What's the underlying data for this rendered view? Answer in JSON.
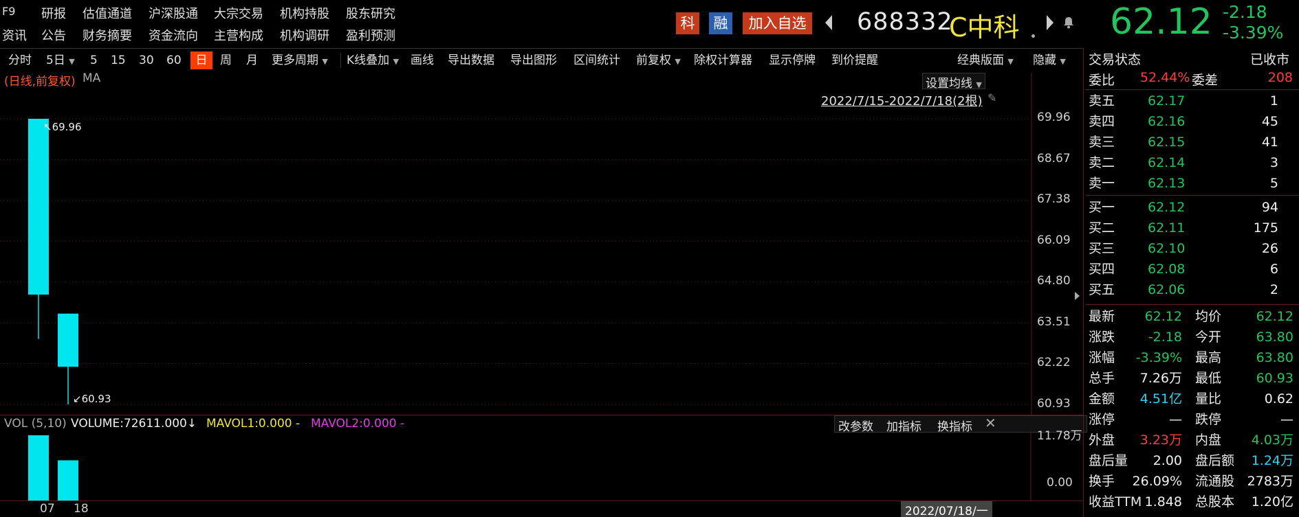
{
  "menu": {
    "row1": [
      "F9",
      "研报",
      "估值通道",
      "沪深股通",
      "大宗交易",
      "机构持股",
      "股东研究"
    ],
    "row2": [
      "资讯",
      "公告",
      "财务摘要",
      "资金流向",
      "主营构成",
      "机构调研",
      "盈利预测"
    ]
  },
  "header": {
    "badge_ke": "科",
    "badge_rong": "融",
    "add_watch": "加入自选",
    "code": "688332",
    "name": "C中科",
    "price": "62.12",
    "change": "-2.18",
    "change_pct": "-3.39%"
  },
  "toolbar": {
    "periods": [
      "分时",
      "5日",
      "5",
      "15",
      "30",
      "60",
      "日",
      "周",
      "月",
      "更多周期"
    ],
    "active_period": "日",
    "tools": [
      "K线叠加",
      "画线",
      "导出数据",
      "导出图形",
      "区间统计",
      "前复权",
      "除权计算器",
      "显示停牌",
      "到价提醒"
    ],
    "layout": "经典版面",
    "hide": "隐藏"
  },
  "chart": {
    "title_type": "(日线,前复权)",
    "title_ma": "MA",
    "set_ma": "设置均线",
    "range_label": "2022/7/15-2022/7/18(2根)",
    "high_annot": "69.96",
    "low_annot": "60.93",
    "y_ticks": [
      "69.96",
      "68.67",
      "67.38",
      "66.09",
      "64.80",
      "63.51",
      "62.22",
      "60.93"
    ],
    "vol_title": "VOL (5,10)",
    "vol_value": "VOLUME:72611.000",
    "mavol1": "MAVOL1:0.000 -",
    "mavol2": "MAVOL2:0.000 -",
    "vol_btns": [
      "改参数",
      "加指标",
      "换指标"
    ],
    "vol_ticks": [
      "11.78万",
      "0.00"
    ],
    "x_labels": [
      "07",
      "18"
    ],
    "cursor_date": "2022/07/18/一",
    "colors": {
      "up": "#ff3d3d",
      "down": "#00e5ee",
      "grid": "#5a1a1a"
    }
  },
  "chart_data": {
    "type": "candlestick",
    "ylim": [
      60.93,
      69.96
    ],
    "candles": [
      {
        "date": "2022/7/15",
        "open": 69.96,
        "close": 64.4,
        "high": 69.96,
        "low": 63.0
      },
      {
        "date": "2022/7/18",
        "open": 63.8,
        "close": 62.12,
        "high": 63.8,
        "low": 60.93
      }
    ],
    "volume": [
      117800,
      72611
    ],
    "vol_ylim": [
      0,
      117800
    ]
  },
  "orderbook": {
    "title": "交易状态",
    "status": "已收市",
    "webi_label": "委比",
    "webi": "52.44%",
    "weicha_label": "委差",
    "weicha": "208",
    "asks": [
      {
        "label": "卖五",
        "price": "62.17",
        "vol": "1"
      },
      {
        "label": "卖四",
        "price": "62.16",
        "vol": "45"
      },
      {
        "label": "卖三",
        "price": "62.15",
        "vol": "41"
      },
      {
        "label": "卖二",
        "price": "62.14",
        "vol": "3"
      },
      {
        "label": "卖一",
        "price": "62.13",
        "vol": "5"
      }
    ],
    "bids": [
      {
        "label": "买一",
        "price": "62.12",
        "vol": "94"
      },
      {
        "label": "买二",
        "price": "62.11",
        "vol": "175"
      },
      {
        "label": "买三",
        "price": "62.10",
        "vol": "26"
      },
      {
        "label": "买四",
        "price": "62.08",
        "vol": "6"
      },
      {
        "label": "买五",
        "price": "62.06",
        "vol": "2"
      }
    ]
  },
  "stats": [
    {
      "l1": "最新",
      "v1": "62.12",
      "c1": "green",
      "l2": "均价",
      "v2": "62.12",
      "c2": "green"
    },
    {
      "l1": "涨跌",
      "v1": "-2.18",
      "c1": "green",
      "l2": "今开",
      "v2": "63.80",
      "c2": "green"
    },
    {
      "l1": "涨幅",
      "v1": "-3.39%",
      "c1": "green",
      "l2": "最高",
      "v2": "63.80",
      "c2": "green"
    },
    {
      "l1": "总手",
      "v1": "7.26万",
      "c1": "white",
      "l2": "最低",
      "v2": "60.93",
      "c2": "green"
    },
    {
      "l1": "金额",
      "v1": "4.51亿",
      "c1": "cyan",
      "l2": "量比",
      "v2": "0.62",
      "c2": "white"
    },
    {
      "l1": "涨停",
      "v1": "—",
      "c1": "white",
      "l2": "跌停",
      "v2": "—",
      "c2": "white"
    },
    {
      "l1": "外盘",
      "v1": "3.23万",
      "c1": "red",
      "l2": "内盘",
      "v2": "4.03万",
      "c2": "green"
    },
    {
      "l1": "盘后量",
      "v1": "2.00",
      "c1": "white",
      "l2": "盘后额",
      "v2": "1.24万",
      "c2": "cyan"
    },
    {
      "l1": "换手",
      "v1": "26.09%",
      "c1": "white",
      "l2": "流通股",
      "v2": "2783万",
      "c2": "white"
    },
    {
      "l1": "收益TTM",
      "v1": "1.848",
      "c1": "white",
      "l2": "总股本",
      "v2": "1.20亿",
      "c2": "white"
    }
  ]
}
